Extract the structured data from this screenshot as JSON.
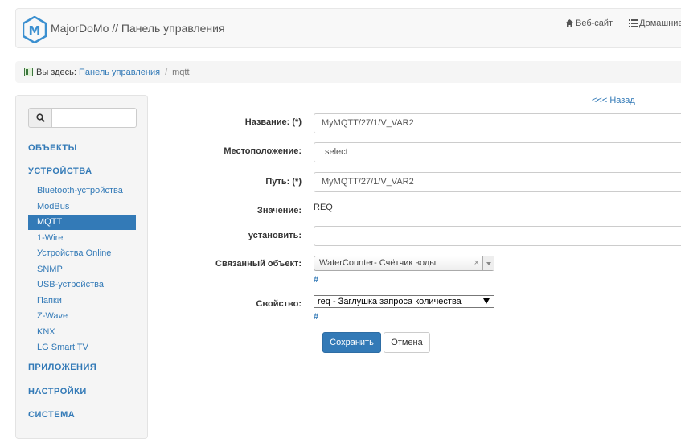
{
  "header": {
    "brand": "MajorDoMo // Панель управления",
    "nav": [
      {
        "label": "Веб-сайт",
        "icon": "home-icon"
      },
      {
        "label": "Домашние",
        "icon": "list-icon"
      }
    ]
  },
  "breadcrumb": {
    "prefix": "Вы здесь:",
    "link": "Панель управления",
    "separator": "/",
    "current": "mqtt"
  },
  "sidebar": {
    "search_placeholder": "",
    "sections": {
      "objects": "ОБЪЕКТЫ",
      "devices": "УСТРОЙСТВА",
      "apps": "ПРИЛОЖЕНИЯ",
      "settings": "НАСТРОЙКИ",
      "system": "СИСТЕМА"
    },
    "device_items": [
      "Bluetooth-устройства",
      "ModBus",
      "MQTT",
      "1-Wire",
      "Устройства Online",
      "SNMP",
      "USB-устройства",
      "Папки",
      "Z-Wave",
      "KNX",
      "LG Smart TV"
    ],
    "active_item": "MQTT"
  },
  "form": {
    "back": "<<< Назад",
    "name_label": "Название: (*)",
    "name_value": "MyMQTT/27/1/V_VAR2",
    "location_label": "Местоположение:",
    "location_value": "select",
    "path_label": "Путь: (*)",
    "path_value": "MyMQTT/27/1/V_VAR2",
    "value_label": "Значение:",
    "value_value": "REQ",
    "set_label": "установить:",
    "set_value": "",
    "linked_label": "Связанный объект:",
    "linked_value": "WaterCounter- Счётчик воды",
    "linked_clear": "×",
    "hash": "#",
    "property_label": "Свойство:",
    "property_value": "req - Заглушка запроса количества",
    "save": "Сохранить",
    "cancel": "Отмена"
  }
}
